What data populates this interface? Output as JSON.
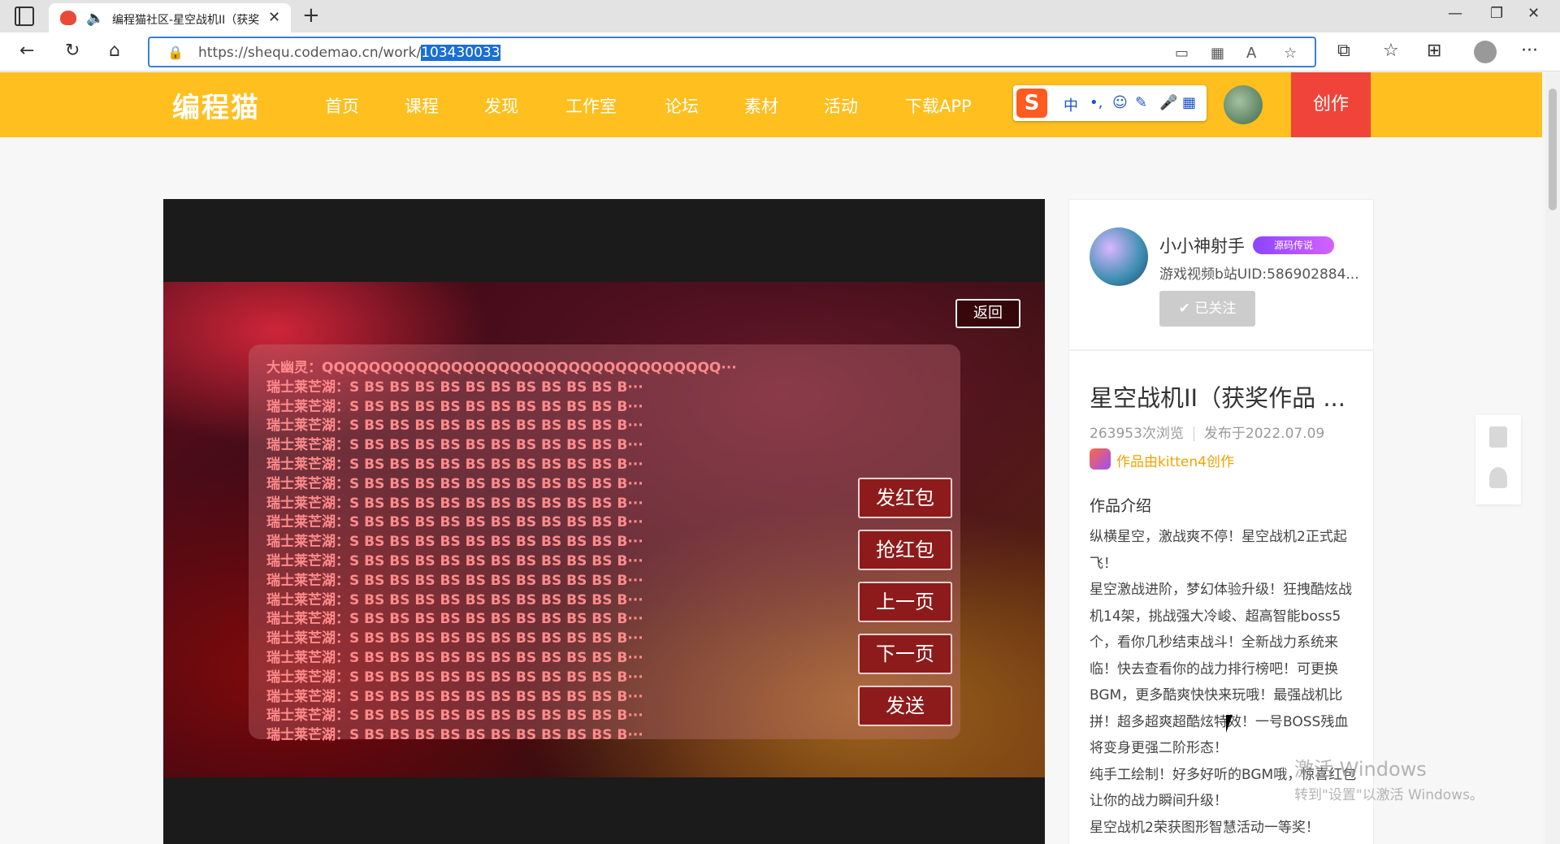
{
  "browser": {
    "tab_title": "编程猫社区-星空战机II（获奖",
    "url_prefix": "https://shequ.codemao.cn/work/",
    "url_selected": "103430033"
  },
  "site": {
    "logo": "编程猫",
    "menu": [
      "首页",
      "课程",
      "发现",
      "工作室",
      "论坛",
      "素材",
      "活动",
      "下载APP"
    ],
    "create": "创作",
    "ime_label": "中"
  },
  "game": {
    "back": "返回",
    "chat_lines": [
      "大幽灵：QQQQQQQQQQQQQQQQQQQQQQQQQQQQQQQQQQ···",
      "瑞士莱芒湖：S BS BS BS BS BS BS BS BS BS BS B···",
      "瑞士莱芒湖：S BS BS BS BS BS BS BS BS BS BS B···",
      "瑞士莱芒湖：S BS BS BS BS BS BS BS BS BS BS B···",
      "瑞士莱芒湖：S BS BS BS BS BS BS BS BS BS BS B···",
      "瑞士莱芒湖：S BS BS BS BS BS BS BS BS BS BS B···",
      "瑞士莱芒湖：S BS BS BS BS BS BS BS BS BS BS B···",
      "瑞士莱芒湖：S BS BS BS BS BS BS BS BS BS BS B···",
      "瑞士莱芒湖：S BS BS BS BS BS BS BS BS BS BS B···",
      "瑞士莱芒湖：S BS BS BS BS BS BS BS BS BS BS B···",
      "瑞士莱芒湖：S BS BS BS BS BS BS BS BS BS BS B···",
      "瑞士莱芒湖：S BS BS BS BS BS BS BS BS BS BS B···",
      "瑞士莱芒湖：S BS BS BS BS BS BS BS BS BS BS B···",
      "瑞士莱芒湖：S BS BS BS BS BS BS BS BS BS BS B···",
      "瑞士莱芒湖：S BS BS BS BS BS BS BS BS BS BS B···",
      "瑞士莱芒湖：S BS BS BS BS BS BS BS BS BS BS B···",
      "瑞士莱芒湖：S BS BS BS BS BS BS BS BS BS BS B···",
      "瑞士莱芒湖：S BS BS BS BS BS BS BS BS BS BS B···",
      "瑞士莱芒湖：S BS BS BS BS BS BS BS BS BS BS B···",
      "瑞士莱芒湖：S BS BS BS BS BS BS BS BS BS BS B···"
    ],
    "buttons": [
      "发红包",
      "抢红包",
      "上一页",
      "下一页",
      "发送"
    ]
  },
  "author": {
    "name": "小小神射手",
    "badge": "源码传说",
    "desc": "游戏视频b站UID:586902884...",
    "follow": "✔ 已关注"
  },
  "work": {
    "title": "星空战机II（获奖作品 ...",
    "views": "263953次浏览",
    "published": "发布于2022.07.09",
    "made_by": "作品由kitten4创作",
    "intro_heading": "作品介绍",
    "intro_lines": [
      "纵横星空，激战爽不停！星空战机2正式起飞！",
      "星空激战进阶，梦幻体验升级！狂拽酷炫战机14架，挑战强大冷峻、超高智能boss5个，看你几秒结束战斗！全新战力系统来临！快去查看你的战力排行榜吧！可更换BGM，更多酷爽快快来玩哦！最强战机比拼！超多超爽超酷炫特效！一号BOSS残血将变身更强二阶形态！",
      "纯手工绘制！好多好听的BGM哦，惊喜红包让你的战力瞬间升级！",
      "星空战机2荣获图形智慧活动一等奖！"
    ]
  },
  "watermark": {
    "line1": "激活 Windows",
    "line2": "转到\"设置\"以激活 Windows。"
  }
}
